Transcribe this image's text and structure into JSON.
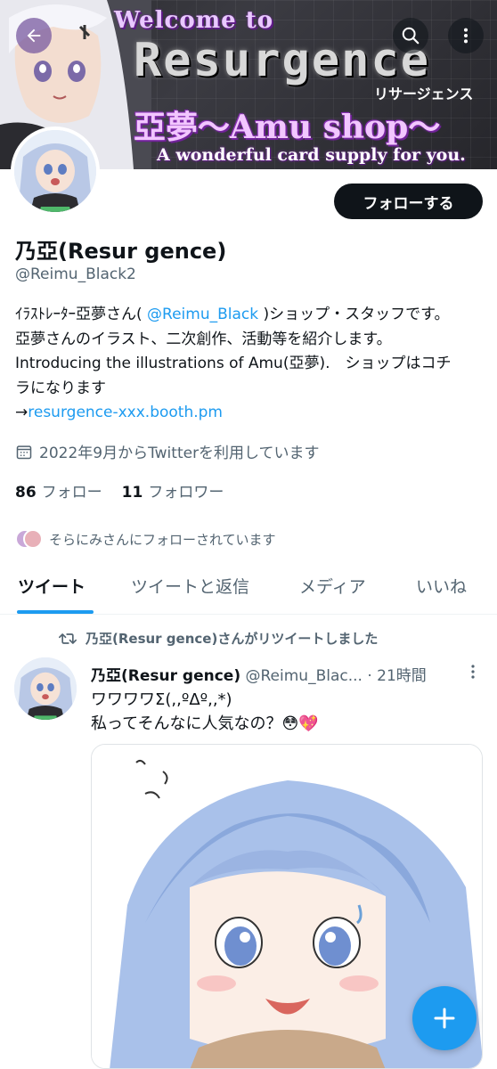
{
  "banner": {
    "welcome": "Welcome to",
    "brand": "Resurgence",
    "brand_kana": "リサージェンス",
    "shop": "亞夢～Amu shop～",
    "tagline": "A wonderful card supply for you."
  },
  "nav": {
    "back_icon": "arrow-left-icon",
    "search_icon": "search-icon",
    "more_icon": "more-vertical-icon"
  },
  "profile": {
    "display_name": "乃亞(Resur gence)",
    "handle": "@Reimu_Black2",
    "follow_label": "フォローする",
    "bio_pre": "ｲﾗｽﾄﾚｰﾀｰ亞夢さん( ",
    "bio_mention": "@Reimu_Black",
    "bio_mid": " )ショップ・スタッフです。 亞夢さんのイラスト、二次創作、活動等を紹介します。Introducing the illustrations of Amu(亞夢).　ショップはコチラになります",
    "bio_arrow": "→",
    "bio_link": "resurgence-xxx.booth.pm",
    "joined": "2022年9月からTwitterを利用しています",
    "following_count": "86",
    "following_label": "フォロー",
    "followers_count": "11",
    "followers_label": "フォロワー",
    "followed_by": "そらにみさんにフォローされています"
  },
  "tabs": [
    {
      "label": "ツイート",
      "active": true
    },
    {
      "label": "ツイートと返信",
      "active": false
    },
    {
      "label": "メディア",
      "active": false
    },
    {
      "label": "いいね",
      "active": false
    }
  ],
  "tweet": {
    "retweet_line": "乃亞(Resur gence)さんがリツイートしました",
    "author_name": "乃亞(Resur gence)",
    "author_handle": "@Reimu_Blac...",
    "separator": "·",
    "time": "21時間",
    "text_line1": "ワワワワΣ(,,ºΔº,,*)",
    "text_line2": "私ってそんなに人気なの？😳💖"
  },
  "fab": {
    "icon": "compose-plus-icon"
  },
  "colors": {
    "accent": "#1d9bf0",
    "text": "#0f1419",
    "muted": "#536471"
  }
}
